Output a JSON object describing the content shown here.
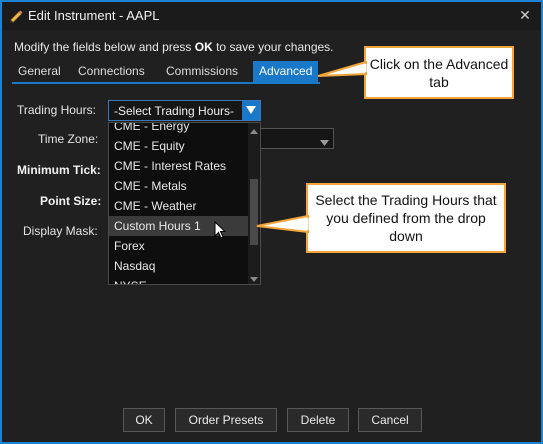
{
  "window": {
    "title": "Edit Instrument - AAPL"
  },
  "instructions": {
    "before": "Modify the fields below and press ",
    "strong": "OK",
    "after": " to save your changes."
  },
  "tabs": [
    {
      "label": "General"
    },
    {
      "label": "Connections"
    },
    {
      "label": "Commissions"
    },
    {
      "label": "Advanced",
      "active": true
    }
  ],
  "form": {
    "trading_hours_label": "Trading Hours:",
    "trading_hours_value": "-Select Trading Hours-",
    "time_zone_label": "Time Zone:",
    "minimum_tick_label": "Minimum Tick:",
    "point_size_label": "Point Size:",
    "display_mask_label": "Display Mask:"
  },
  "dropdown": {
    "options": [
      "CME - Energy",
      "CME - Equity",
      "CME - Interest Rates",
      "CME - Metals",
      "CME - Weather",
      "Custom Hours 1",
      "Forex",
      "Nasdaq",
      "NYSE"
    ],
    "hovered": "Custom Hours 1"
  },
  "callouts": {
    "advanced_tab": "Click on the Advanced tab",
    "trading_hours": "Select the Trading Hours that you defined from the drop down"
  },
  "buttons": {
    "ok": "OK",
    "order_presets": "Order Presets",
    "delete": "Delete",
    "cancel": "Cancel"
  },
  "colors": {
    "accent": "#1a78c8",
    "border": "#1d84d4",
    "callout_border": "#f4a53a",
    "background": "#202020"
  },
  "icons": {
    "title": "pencil-icon",
    "close": "close-icon",
    "dropdown": "chevron-down-icon",
    "cursor": "mouse-pointer-icon"
  }
}
